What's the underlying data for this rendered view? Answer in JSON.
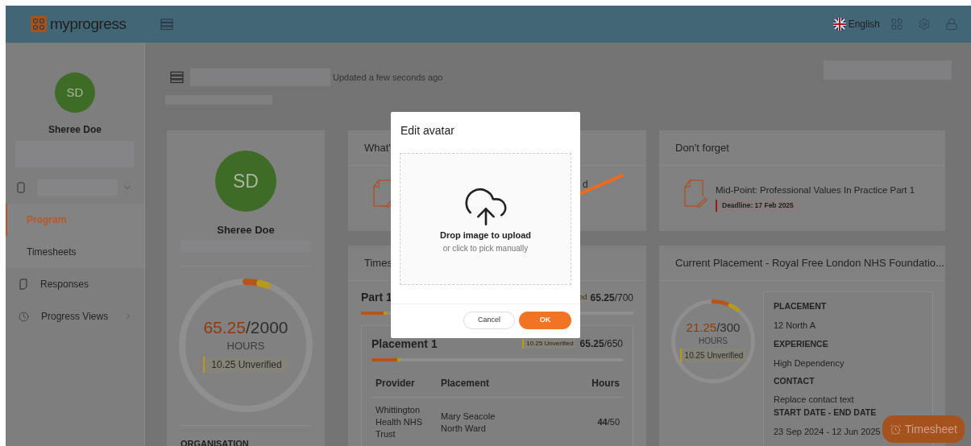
{
  "header": {
    "logo": "myprogress",
    "language": "English"
  },
  "toolbar": {
    "status": "Updated a few seconds ago"
  },
  "sidebar": {
    "avatar": "SD",
    "name": "Sheree Doe",
    "nav": [
      {
        "kind": "sub",
        "label": "Program",
        "selected": true,
        "has_submenu": false
      },
      {
        "kind": "sub",
        "label": "Timesheets",
        "selected": false,
        "has_submenu": false
      },
      {
        "kind": "main",
        "label": "Responses",
        "selected": false,
        "has_submenu": false
      },
      {
        "kind": "main",
        "label": "Progress Views",
        "selected": false,
        "has_submenu": true
      }
    ]
  },
  "profile_card": {
    "avatar": "SD",
    "name": "Sheree Doe",
    "ring": {
      "value": "65.25",
      "total": "/2000",
      "unit": "HOURS",
      "unverified": "10.25 Unverified",
      "segments": [
        {
          "kind": "verified",
          "level": 0.035
        },
        {
          "kind": "unverified",
          "level": 0.02
        }
      ]
    },
    "section_label": "ORGANISATION"
  },
  "whats_card": {
    "title": "What'",
    "fragment": "d"
  },
  "timesheets_card": {
    "title": "Times",
    "part": {
      "title": "Part 1",
      "badge_fragment": "ed",
      "value": "65.25",
      "total": "/700",
      "bar": {
        "level": 0.095
      }
    },
    "placement": {
      "title": "Placement 1",
      "unverified": "10.25 Unverified",
      "value": "65.25",
      "total": "/650",
      "bar": {
        "level": 0.115
      },
      "columns": [
        "Provider",
        "Placement",
        "Hours"
      ],
      "rows": [
        {
          "provider": "Whittington Health NHS Trust",
          "placement": "Mary Seacole North Ward",
          "hours_value": "44",
          "hours_total": "/50"
        }
      ]
    }
  },
  "dont_forget": {
    "title": "Don't forget",
    "items": [
      {
        "title": "Mid-Point: Professional Values In Practice Part 1",
        "deadline": "Deadline: 17 Feb 2025"
      }
    ]
  },
  "current_placement": {
    "title": "Current Placement - Royal Free London NHS Foundatio...",
    "ring": {
      "value": "21.25",
      "total": "/300",
      "unit": "HOURS",
      "unverified": "10.25 Unverified",
      "segments": [
        {
          "kind": "verified",
          "level": 0.07
        },
        {
          "kind": "unverified",
          "level": 0.035
        }
      ]
    },
    "details": [
      {
        "label": "PLACEMENT",
        "value": "12 North A"
      },
      {
        "label": "EXPERIENCE",
        "value": "High Dependency"
      },
      {
        "label": "CONTACT",
        "value": "Replace contact text"
      },
      {
        "label": "START DATE - END DATE",
        "value": "23 Sep 2024 - 12 Jun 2025"
      }
    ]
  },
  "timesheet_button": "Timesheet",
  "modal": {
    "title": "Edit avatar",
    "drop_title": "Drop image to upload",
    "drop_hint": "or click to pick manually",
    "buttons": [
      {
        "kind": "secondary",
        "label": "Cancel"
      },
      {
        "kind": "primary",
        "label": "OK"
      }
    ]
  }
}
